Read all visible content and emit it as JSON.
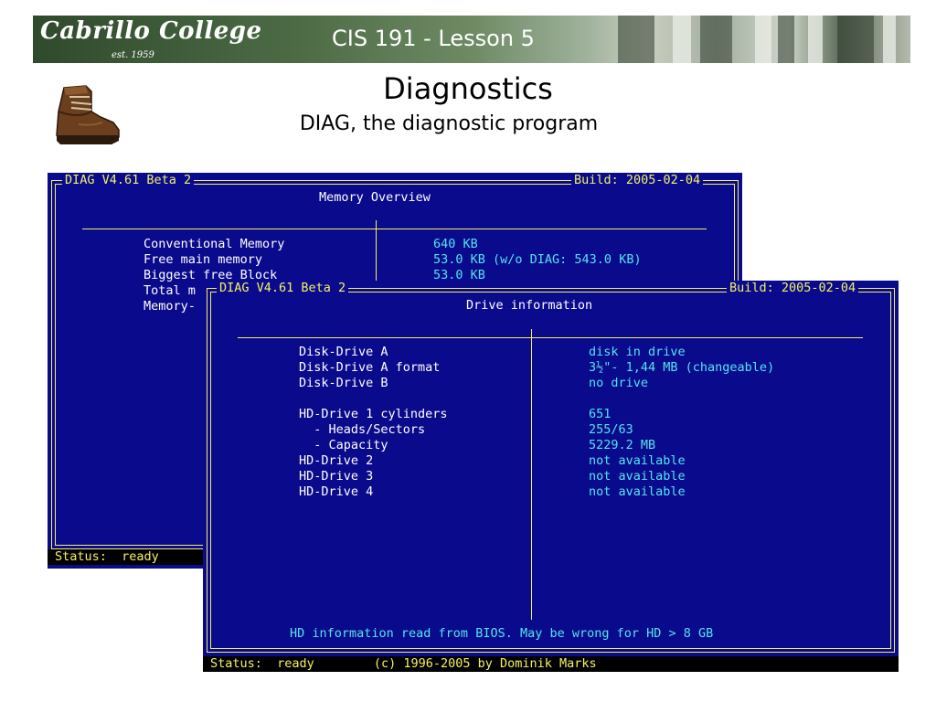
{
  "header": {
    "logo_text": "Cabrillo College",
    "logo_est": "est. 1959",
    "course": "CIS 191 - Lesson 5"
  },
  "slide": {
    "title": "Diagnostics",
    "subtitle": "DIAG, the diagnostic program",
    "boot_icon": "boot-icon"
  },
  "screen_back": {
    "app": "DIAG V4.61 Beta 2",
    "build": "Build: 2005-02-04",
    "panel_title": "Memory Overview",
    "rows": [
      {
        "label": "Conventional Memory",
        "value": "640 KB"
      },
      {
        "label": "Free main memory",
        "value": "53.0 KB (w/o DIAG: 543.0 KB)"
      },
      {
        "label": "Biggest free Block",
        "value": "53.0 KB"
      },
      {
        "label": "Total m",
        "value": ""
      },
      {
        "label": "Memory-",
        "value": ""
      }
    ],
    "status_label": "Status:",
    "status_value": "ready"
  },
  "screen_front": {
    "app": "DIAG V4.61 Beta 2",
    "build": "Build: 2005-02-04",
    "panel_title": "Drive information",
    "rows": [
      {
        "label": "Disk-Drive A",
        "value": "disk in drive"
      },
      {
        "label": "Disk-Drive A format",
        "value": "3½\"- 1,44 MB (changeable)"
      },
      {
        "label": "Disk-Drive B",
        "value": "no drive"
      },
      {
        "label": "HD-Drive 1 cylinders",
        "value": "651"
      },
      {
        "label": "  - Heads/Sectors",
        "value": "255/63"
      },
      {
        "label": "  - Capacity",
        "value": "5229.2 MB"
      },
      {
        "label": "HD-Drive 2",
        "value": "not available"
      },
      {
        "label": "HD-Drive 3",
        "value": "not available"
      },
      {
        "label": "HD-Drive 4",
        "value": "not available"
      }
    ],
    "footer_note": "HD information read from BIOS. May be wrong for HD > 8 GB",
    "status_label": "Status:",
    "status_value": "ready",
    "copyright": "(c) 1996-2005 by Dominik Marks"
  },
  "colors": {
    "dos_background": "#0a0a8c",
    "dos_frame": "#f4f262",
    "dos_value": "#52e5ee"
  }
}
